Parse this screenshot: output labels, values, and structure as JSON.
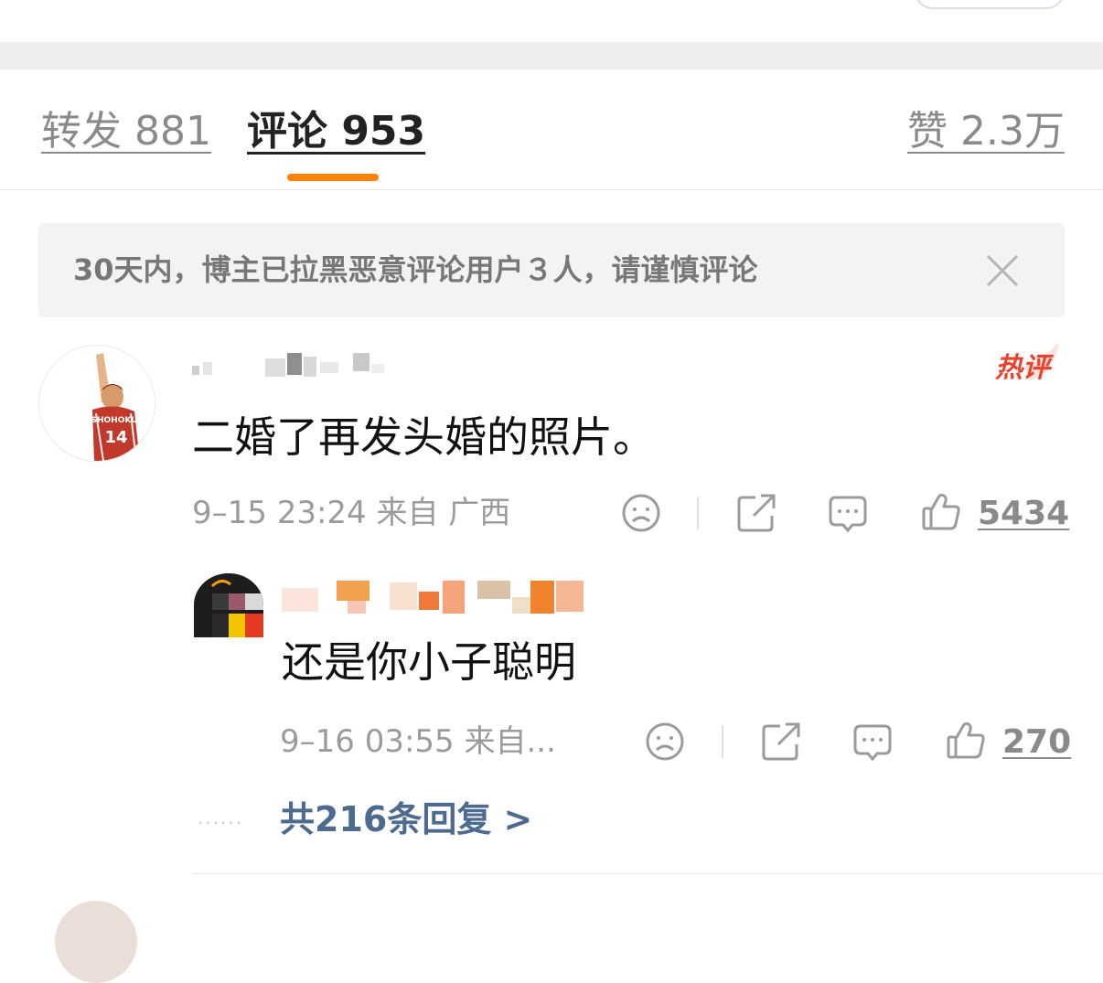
{
  "tabs": {
    "repost": "转发 881",
    "comments": "评论 953",
    "likes": "赞 2.3万"
  },
  "notice": {
    "text": "30天内，博主已拉黑恶意评论用户３人，请谨慎评论"
  },
  "comment": {
    "badge": "热评",
    "avatar_jersey": "SHOHOKU",
    "avatar_number": "14",
    "text": "二婚了再发头婚的照片。",
    "meta": "9–15 23:24 来自 广西",
    "like_count": "5434"
  },
  "reply": {
    "text": "还是你小子聪明",
    "meta": "9–16 03:55 来自...",
    "like_count": "270"
  },
  "more_replies": {
    "label": "共216条回复 >"
  },
  "colors": {
    "accent": "#ff8200",
    "hot_badge": "#e9432f",
    "link": "#4d6b8e"
  }
}
